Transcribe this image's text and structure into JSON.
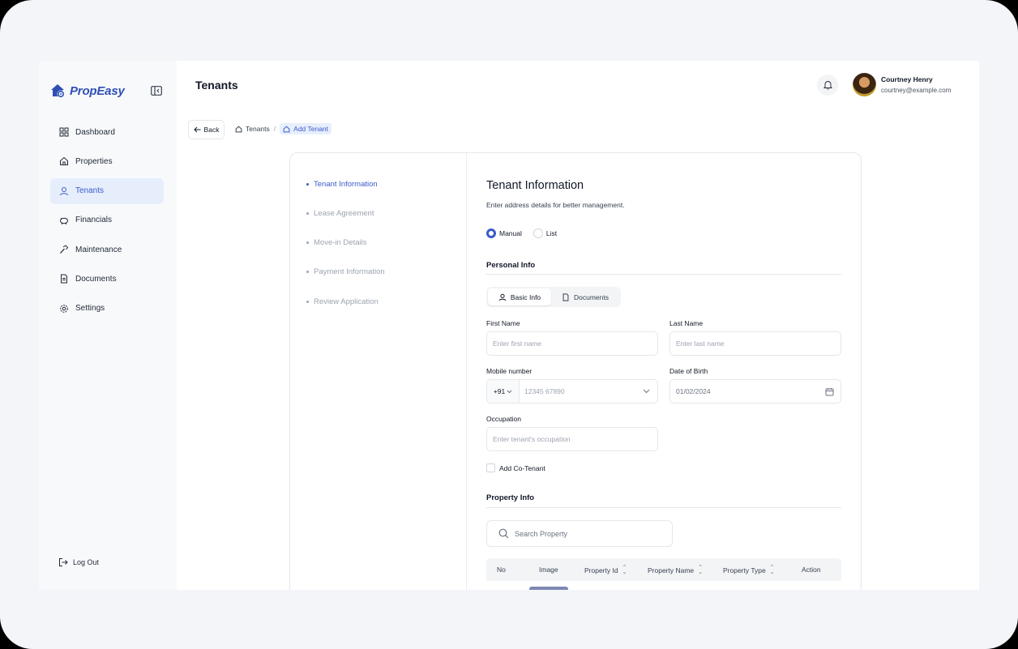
{
  "brand": {
    "name": "PropEasy",
    "color": "#2f4fb5",
    "icon": "house-gear-logo"
  },
  "sidebar": {
    "items": [
      {
        "label": "Dashboard",
        "icon": "grid-icon",
        "active": false
      },
      {
        "label": "Properties",
        "icon": "home-icon",
        "active": false
      },
      {
        "label": "Tenants",
        "icon": "user-icon",
        "active": true
      },
      {
        "label": "Financials",
        "icon": "piggy-bank-icon",
        "active": false
      },
      {
        "label": "Maintenance",
        "icon": "hammer-icon",
        "active": false
      },
      {
        "label": "Documents",
        "icon": "file-text-icon",
        "active": false
      },
      {
        "label": "Settings",
        "icon": "gear-icon",
        "active": false
      }
    ],
    "logout_label": "Log Out"
  },
  "header": {
    "title": "Tenants",
    "user": {
      "name": "Courtney Henry",
      "email": "courtney@example.com"
    }
  },
  "breadcrumb": {
    "back_label": "Back",
    "items": [
      {
        "label": "Tenants"
      },
      {
        "label": "Add Tenant",
        "current": true
      }
    ]
  },
  "steps": [
    {
      "label": "Tenant Information",
      "active": true
    },
    {
      "label": "Lease Agreement",
      "active": false
    },
    {
      "label": "Move-in Details",
      "active": false
    },
    {
      "label": "Payment Information",
      "active": false
    },
    {
      "label": "Review Application",
      "active": false
    }
  ],
  "form": {
    "title": "Tenant Information",
    "subtitle": "Enter address details for better management.",
    "mode_options": [
      {
        "label": "Manual",
        "selected": true
      },
      {
        "label": "List",
        "selected": false
      }
    ],
    "personal_info_title": "Personal Info",
    "tabs": [
      {
        "label": "Basic Info",
        "icon": "user-icon",
        "active": true
      },
      {
        "label": "Documents",
        "icon": "file-icon",
        "active": false
      }
    ],
    "first_name": {
      "label": "First Name",
      "placeholder": "Enter first name"
    },
    "last_name": {
      "label": "Last Name",
      "placeholder": "Enter last name"
    },
    "mobile": {
      "label": "Mobile number",
      "country_code": "+91",
      "placeholder": "12345 67890"
    },
    "dob": {
      "label": "Date of Birth",
      "value": "01/02/2024"
    },
    "occupation": {
      "label": "Occupation",
      "placeholder": "Enter tenant's occupation"
    },
    "co_tenant_label": "Add Co-Tenant",
    "property_info_title": "Property Info",
    "search_placeholder": "Search Property",
    "table": {
      "columns": [
        "No",
        "Image",
        "Property Id",
        "Property Name",
        "Property Type",
        "Action"
      ]
    }
  },
  "colors": {
    "accent": "#3b5bcc",
    "active_bg": "#e6eefc"
  }
}
